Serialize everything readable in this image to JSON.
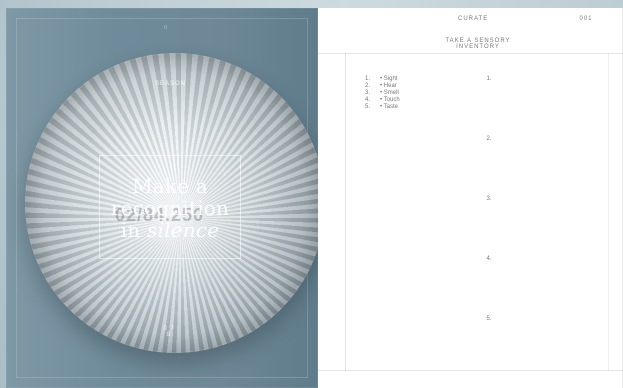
{
  "left_page": {
    "top_marker": "○",
    "wood_top_label": "SEASON",
    "wood_bottom_label": "0 7 8",
    "title": {
      "line1": "Make a",
      "line2": "recognition",
      "line3_prefix": "in ",
      "line3_em": "silence"
    }
  },
  "right_page": {
    "header": {
      "center": "CURATE",
      "right": "001"
    },
    "section_title": "TAKE A SENSORY INVENTORY",
    "senses": [
      {
        "num": "1.",
        "label": "• Sight"
      },
      {
        "num": "2.",
        "label": "• Hear"
      },
      {
        "num": "3.",
        "label": "• Smell"
      },
      {
        "num": "4.",
        "label": "• Touch"
      },
      {
        "num": "5.",
        "label": "• Taste"
      }
    ],
    "prompts": [
      "1.",
      "2.",
      "3.",
      "4.",
      "5."
    ]
  }
}
